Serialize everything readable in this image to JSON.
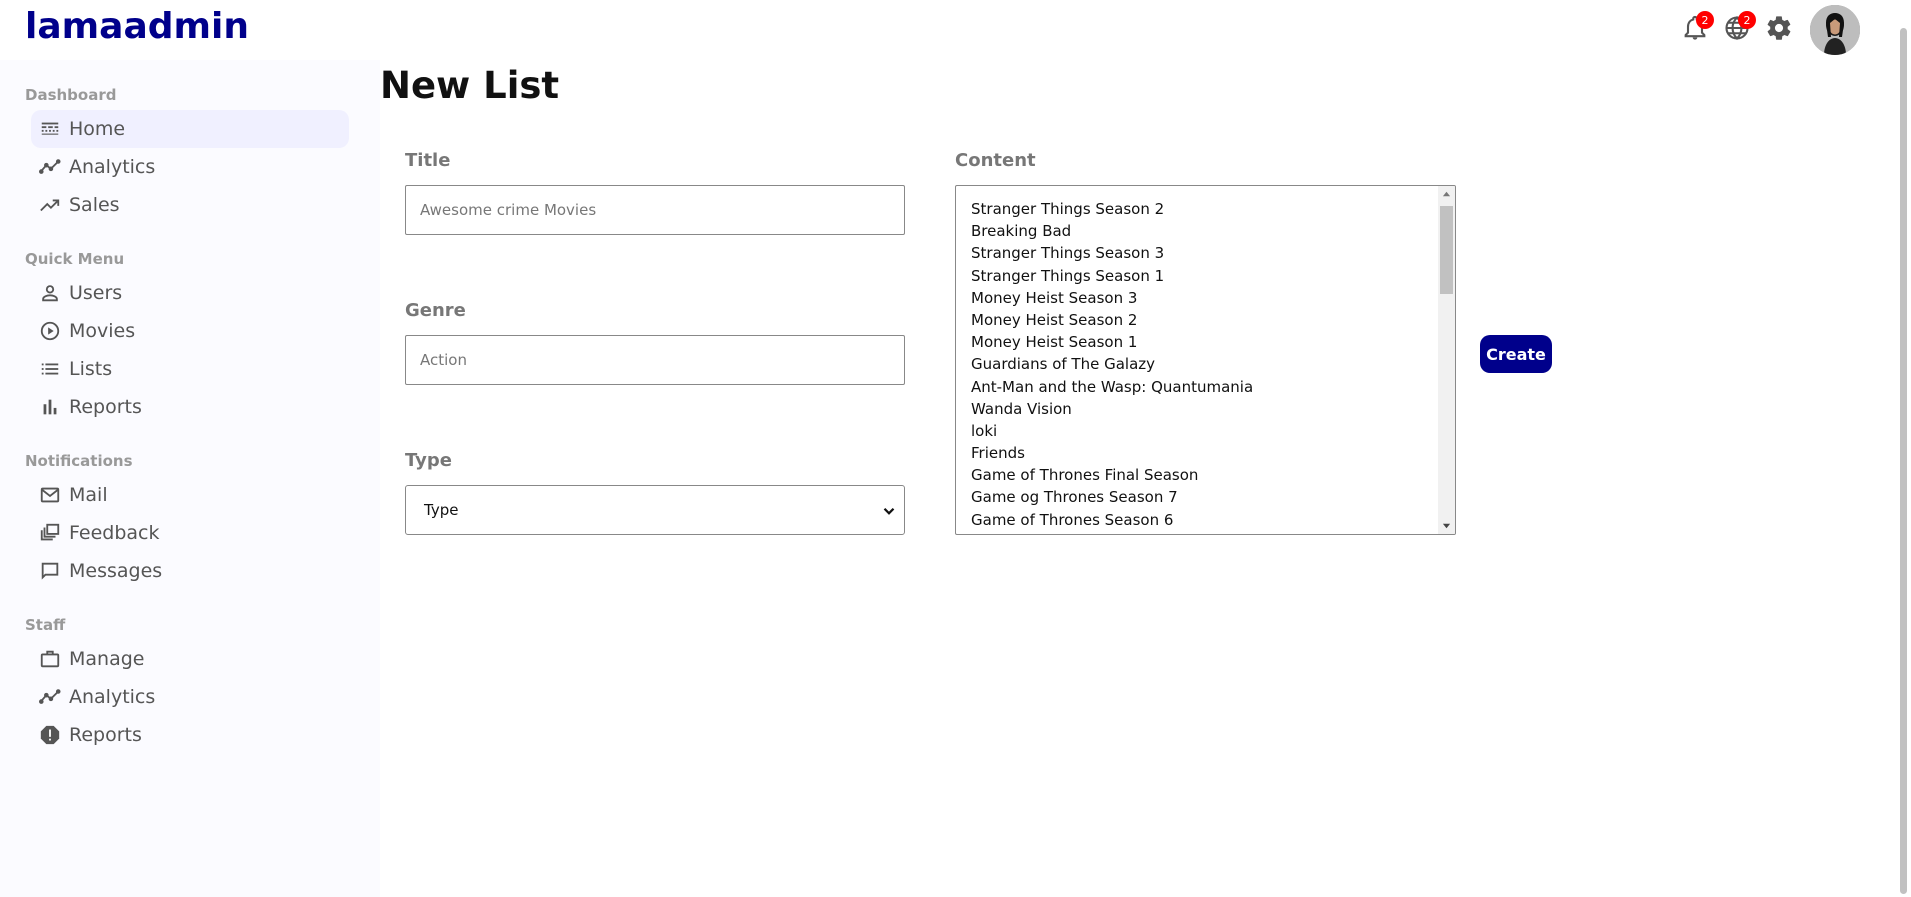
{
  "app": {
    "logo": "lamaadmin"
  },
  "topbar": {
    "notifications_badge": "2",
    "language_badge": "2"
  },
  "sidebar": {
    "sections": [
      {
        "title": "Dashboard",
        "items": [
          {
            "label": "Home",
            "icon": "line-style-icon",
            "active": true
          },
          {
            "label": "Analytics",
            "icon": "timeline-icon"
          },
          {
            "label": "Sales",
            "icon": "trending-up-icon"
          }
        ]
      },
      {
        "title": "Quick Menu",
        "items": [
          {
            "label": "Users",
            "icon": "person-outline-icon"
          },
          {
            "label": "Movies",
            "icon": "play-circle-icon"
          },
          {
            "label": "Lists",
            "icon": "list-icon"
          },
          {
            "label": "Reports",
            "icon": "bar-chart-icon"
          }
        ]
      },
      {
        "title": "Notifications",
        "items": [
          {
            "label": "Mail",
            "icon": "mail-outline-icon"
          },
          {
            "label": "Feedback",
            "icon": "dynamic-feed-icon"
          },
          {
            "label": "Messages",
            "icon": "chat-bubble-outline-icon"
          }
        ]
      },
      {
        "title": "Staff",
        "items": [
          {
            "label": "Manage",
            "icon": "work-outline-icon"
          },
          {
            "label": "Analytics",
            "icon": "timeline-icon"
          },
          {
            "label": "Reports",
            "icon": "report-icon"
          }
        ]
      }
    ]
  },
  "main": {
    "title": "New List",
    "form": {
      "title_label": "Title",
      "title_placeholder": "Awesome crime Movies",
      "genre_label": "Genre",
      "genre_placeholder": "Action",
      "type_label": "Type",
      "type_selected": "Type",
      "content_label": "Content",
      "content_options": [
        "Stranger Things Season 2",
        "Breaking Bad",
        "Stranger Things Season 3",
        "Stranger Things Season 1",
        "Money Heist Season 3",
        "Money Heist Season 2",
        "Money Heist Season 1",
        "Guardians of The Galazy",
        "Ant-Man and the Wasp: Quantumania",
        "Wanda Vision",
        "loki",
        "Friends",
        "Game of Thrones Final Season",
        "Game og Thrones Season 7",
        "Game of Thrones Season 6"
      ],
      "create_label": "Create"
    }
  },
  "colors": {
    "brand": "#00008b",
    "badge": "#ff0000",
    "sidebar_bg": "#fbfbff",
    "active_item_bg": "#f0f0ff"
  }
}
